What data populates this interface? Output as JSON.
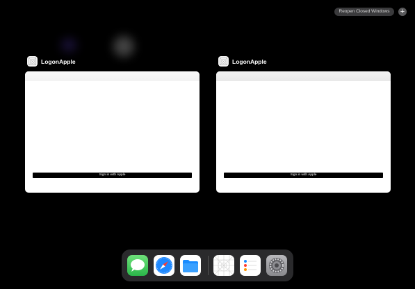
{
  "toolbar": {
    "reopen_label": "Reopen Closed Windows",
    "add_label": "+"
  },
  "windows": [
    {
      "app_name": "LogonApple",
      "signin_label": " Sign in with Apple"
    },
    {
      "app_name": "LogonApple",
      "signin_label": " Sign in with Apple"
    }
  ],
  "dock": {
    "items": [
      {
        "name": "Messages",
        "icon": "messages-icon"
      },
      {
        "name": "Safari",
        "icon": "safari-icon"
      },
      {
        "name": "Files",
        "icon": "files-icon"
      },
      {
        "name": "LogonApple",
        "icon": "app-placeholder-icon"
      },
      {
        "name": "Reminders",
        "icon": "reminders-icon"
      },
      {
        "name": "Settings",
        "icon": "settings-icon"
      }
    ]
  },
  "colors": {
    "background": "#000000",
    "dock": "#2a2a2c",
    "messages_green": "#34c759",
    "safari_blue": "#1e88ff",
    "files_blue": "#1a8cff"
  }
}
